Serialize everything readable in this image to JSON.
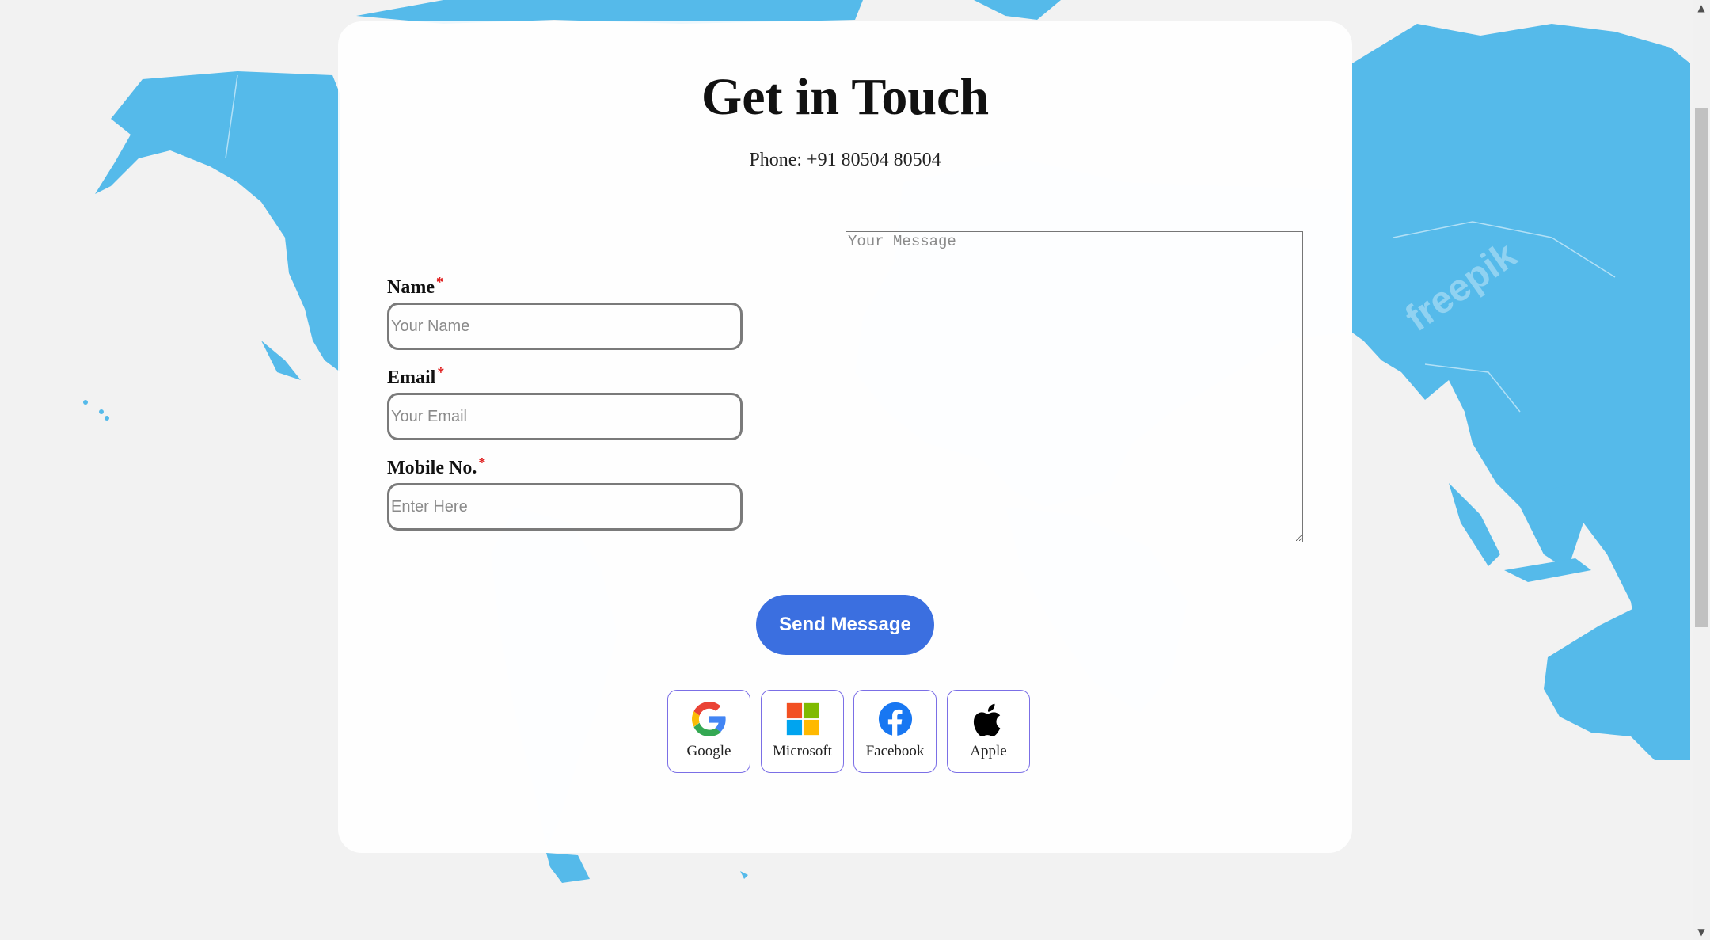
{
  "page": {
    "title": "Get in Touch",
    "phone": "Phone: +91 80504 80504"
  },
  "form": {
    "name": {
      "label": "Name",
      "required_mark": "*",
      "placeholder": "Your Name",
      "value": ""
    },
    "email": {
      "label": "Email",
      "required_mark": "*",
      "placeholder": "Your Email",
      "value": ""
    },
    "mobile": {
      "label": "Mobile No.",
      "required_mark": "*",
      "placeholder": "Enter Here",
      "value": ""
    },
    "message": {
      "placeholder": "Your Message",
      "value": ""
    },
    "submit_label": "Send Message"
  },
  "social_logins": [
    {
      "label": "Google",
      "icon": "google-icon"
    },
    {
      "label": "Microsoft",
      "icon": "microsoft-icon"
    },
    {
      "label": "Facebook",
      "icon": "facebook-icon"
    },
    {
      "label": "Apple",
      "icon": "apple-icon"
    }
  ],
  "background": {
    "watermark": "freepik",
    "map_color": "#55baea",
    "page_color": "#f2f2f2"
  },
  "colors": {
    "accent": "#3b6fe0",
    "required": "#e02020",
    "social_border": "#7b6fe6"
  },
  "scrollbar": {
    "up_arrow": "▲",
    "down_arrow": "▼"
  }
}
